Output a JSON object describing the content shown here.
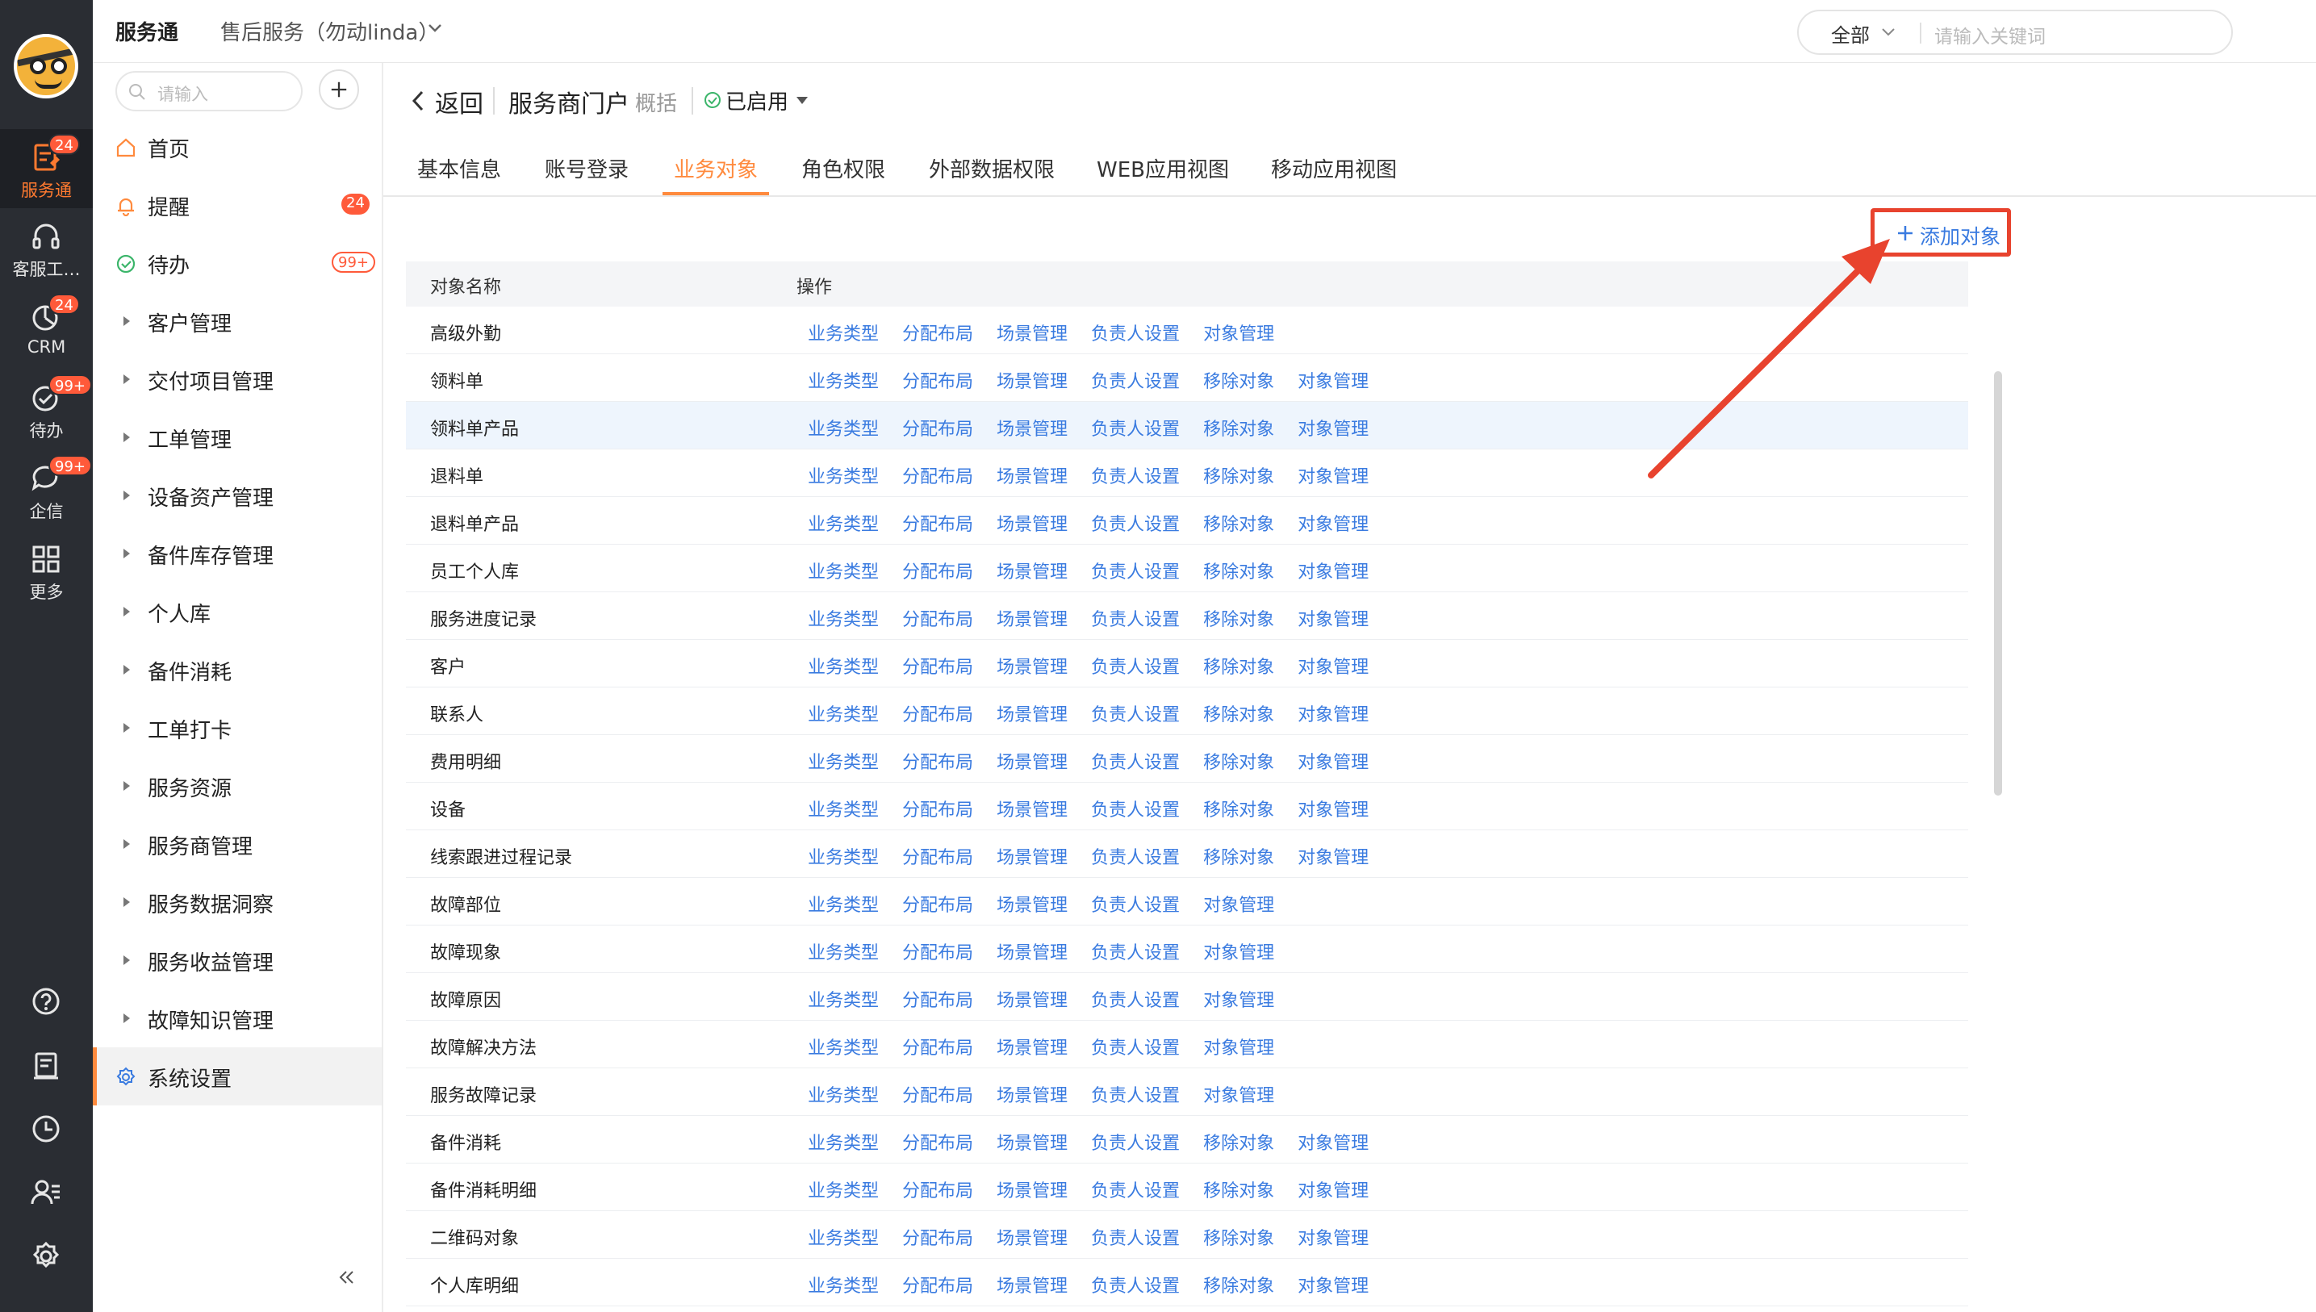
{
  "rail": {
    "items": [
      {
        "label": "服务通",
        "badge": "24"
      },
      {
        "label": "客服工…",
        "badge": ""
      },
      {
        "label": "CRM",
        "badge": "24"
      },
      {
        "label": "待办",
        "badge": "99+"
      },
      {
        "label": "企信",
        "badge": "99+"
      },
      {
        "label": "更多",
        "badge": ""
      }
    ]
  },
  "topbar": {
    "app_title": "服务通",
    "app_subtitle": "售后服务（勿动linda）",
    "search_scope": "全部",
    "search_placeholder": "请输入关键词"
  },
  "sidebar": {
    "search_placeholder": "请输入",
    "items": [
      {
        "label": "首页",
        "badge": ""
      },
      {
        "label": "提醒",
        "badge": "24"
      },
      {
        "label": "待办",
        "badge": "99+"
      },
      {
        "label": "客户管理"
      },
      {
        "label": "交付项目管理"
      },
      {
        "label": "工单管理"
      },
      {
        "label": "设备资产管理"
      },
      {
        "label": "备件库存管理"
      },
      {
        "label": "个人库"
      },
      {
        "label": "备件消耗"
      },
      {
        "label": "工单打卡"
      },
      {
        "label": "服务资源"
      },
      {
        "label": "服务商管理"
      },
      {
        "label": "服务数据洞察"
      },
      {
        "label": "服务收益管理"
      },
      {
        "label": "故障知识管理"
      },
      {
        "label": "系统设置"
      }
    ]
  },
  "main": {
    "back_label": "返回",
    "portal_name": "服务商门户",
    "overview_label": "概括",
    "status_label": "已启用",
    "tabs": [
      "基本信息",
      "账号登录",
      "业务对象",
      "角色权限",
      "外部数据权限",
      "WEB应用视图",
      "移动应用视图"
    ],
    "active_tab": "业务对象",
    "add_object_label": "添加对象",
    "table": {
      "columns": [
        "对象名称",
        "操作"
      ],
      "rows": [
        {
          "name": "高级外勤",
          "actions": [
            "业务类型",
            "分配布局",
            "场景管理",
            "负责人设置",
            "对象管理"
          ]
        },
        {
          "name": "领料单",
          "actions": [
            "业务类型",
            "分配布局",
            "场景管理",
            "负责人设置",
            "移除对象",
            "对象管理"
          ]
        },
        {
          "name": "领料单产品",
          "actions": [
            "业务类型",
            "分配布局",
            "场景管理",
            "负责人设置",
            "移除对象",
            "对象管理"
          ]
        },
        {
          "name": "退料单",
          "actions": [
            "业务类型",
            "分配布局",
            "场景管理",
            "负责人设置",
            "移除对象",
            "对象管理"
          ]
        },
        {
          "name": "退料单产品",
          "actions": [
            "业务类型",
            "分配布局",
            "场景管理",
            "负责人设置",
            "移除对象",
            "对象管理"
          ]
        },
        {
          "name": "员工个人库",
          "actions": [
            "业务类型",
            "分配布局",
            "场景管理",
            "负责人设置",
            "移除对象",
            "对象管理"
          ]
        },
        {
          "name": "服务进度记录",
          "actions": [
            "业务类型",
            "分配布局",
            "场景管理",
            "负责人设置",
            "移除对象",
            "对象管理"
          ]
        },
        {
          "name": "客户",
          "actions": [
            "业务类型",
            "分配布局",
            "场景管理",
            "负责人设置",
            "移除对象",
            "对象管理"
          ]
        },
        {
          "name": "联系人",
          "actions": [
            "业务类型",
            "分配布局",
            "场景管理",
            "负责人设置",
            "移除对象",
            "对象管理"
          ]
        },
        {
          "name": "费用明细",
          "actions": [
            "业务类型",
            "分配布局",
            "场景管理",
            "负责人设置",
            "移除对象",
            "对象管理"
          ]
        },
        {
          "name": "设备",
          "actions": [
            "业务类型",
            "分配布局",
            "场景管理",
            "负责人设置",
            "移除对象",
            "对象管理"
          ]
        },
        {
          "name": "线索跟进过程记录",
          "actions": [
            "业务类型",
            "分配布局",
            "场景管理",
            "负责人设置",
            "移除对象",
            "对象管理"
          ]
        },
        {
          "name": "故障部位",
          "actions": [
            "业务类型",
            "分配布局",
            "场景管理",
            "负责人设置",
            "对象管理"
          ]
        },
        {
          "name": "故障现象",
          "actions": [
            "业务类型",
            "分配布局",
            "场景管理",
            "负责人设置",
            "对象管理"
          ]
        },
        {
          "name": "故障原因",
          "actions": [
            "业务类型",
            "分配布局",
            "场景管理",
            "负责人设置",
            "对象管理"
          ]
        },
        {
          "name": "故障解决方法",
          "actions": [
            "业务类型",
            "分配布局",
            "场景管理",
            "负责人设置",
            "对象管理"
          ]
        },
        {
          "name": "服务故障记录",
          "actions": [
            "业务类型",
            "分配布局",
            "场景管理",
            "负责人设置",
            "对象管理"
          ]
        },
        {
          "name": "备件消耗",
          "actions": [
            "业务类型",
            "分配布局",
            "场景管理",
            "负责人设置",
            "移除对象",
            "对象管理"
          ]
        },
        {
          "name": "备件消耗明细",
          "actions": [
            "业务类型",
            "分配布局",
            "场景管理",
            "负责人设置",
            "移除对象",
            "对象管理"
          ]
        },
        {
          "name": "二维码对象",
          "actions": [
            "业务类型",
            "分配布局",
            "场景管理",
            "负责人设置",
            "移除对象",
            "对象管理"
          ]
        },
        {
          "name": "个人库明细",
          "actions": [
            "业务类型",
            "分配布局",
            "场景管理",
            "负责人设置",
            "移除对象",
            "对象管理"
          ]
        }
      ]
    }
  },
  "colors": {
    "accent": "#ff8a3d",
    "link": "#3a7be0",
    "badge": "#ff5a3a",
    "rail_bg": "#2a2d33",
    "annotation": "#e8432e"
  }
}
